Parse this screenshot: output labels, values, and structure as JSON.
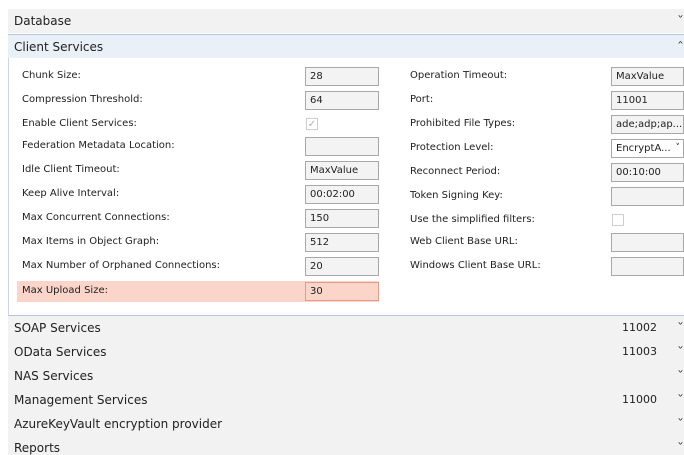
{
  "sections": {
    "database": {
      "title": "Database"
    },
    "client_services": {
      "title": "Client Services"
    },
    "soap": {
      "title": "SOAP Services",
      "port": "11002"
    },
    "odata": {
      "title": "OData Services",
      "port": "11003"
    },
    "nas": {
      "title": "NAS Services"
    },
    "management": {
      "title": "Management Services",
      "port": "11000"
    },
    "azure": {
      "title": "AzureKeyVault encryption provider"
    },
    "reports": {
      "title": "Reports"
    }
  },
  "icons": {
    "collapsed": "chevron-down-icon",
    "expanded": "chevron-up-icon",
    "chevron_down": "˅",
    "chevron_up": "˄",
    "checkmark": "✓"
  },
  "highlight_color": "#fbd5ca",
  "client": {
    "left": [
      {
        "label": "Chunk Size:",
        "value": "28"
      },
      {
        "label": "Compression Threshold:",
        "value": "64"
      },
      {
        "label": "Enable Client Services:",
        "checked": true
      },
      {
        "label": "Federation Metadata Location:",
        "value": ""
      },
      {
        "label": "Idle Client Timeout:",
        "value": "MaxValue"
      },
      {
        "label": "Keep Alive Interval:",
        "value": "00:02:00"
      },
      {
        "label": "Max Concurrent Connections:",
        "value": "150"
      },
      {
        "label": "Max Items in Object Graph:",
        "value": "512"
      },
      {
        "label": "Max Number of Orphaned Connections:",
        "value": "20"
      },
      {
        "label": "Max Upload Size:",
        "value": "30"
      }
    ],
    "right": [
      {
        "label": "Operation Timeout:",
        "value": "MaxValue"
      },
      {
        "label": "Port:",
        "value": "11001"
      },
      {
        "label": "Prohibited File Types:",
        "value": "ade;adp;ap..."
      },
      {
        "label": "Protection Level:",
        "value": "EncryptA..."
      },
      {
        "label": "Reconnect Period:",
        "value": "00:10:00"
      },
      {
        "label": "Token Signing Key:",
        "value": ""
      },
      {
        "label": "Use the simplified filters:",
        "checked": false
      },
      {
        "label": "Web Client Base URL:",
        "value": ""
      },
      {
        "label": "Windows Client Base URL:",
        "value": ""
      }
    ]
  }
}
